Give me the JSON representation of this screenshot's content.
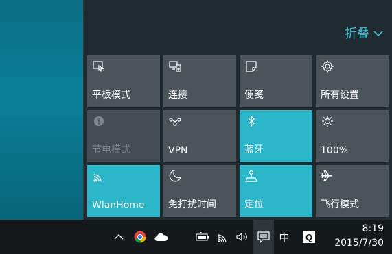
{
  "action_center": {
    "collapse_label": "折叠",
    "tiles": [
      {
        "label": "平板模式",
        "icon": "tablet-mode-icon",
        "state": "normal"
      },
      {
        "label": "连接",
        "icon": "connect-icon",
        "state": "normal"
      },
      {
        "label": "便笺",
        "icon": "note-icon",
        "state": "normal"
      },
      {
        "label": "所有设置",
        "icon": "settings-gear-icon",
        "state": "normal"
      },
      {
        "label": "节电模式",
        "icon": "battery-saver-icon",
        "state": "disabled"
      },
      {
        "label": "VPN",
        "icon": "vpn-icon",
        "state": "normal"
      },
      {
        "label": "蓝牙",
        "icon": "bluetooth-icon",
        "state": "active"
      },
      {
        "label": "100%",
        "icon": "brightness-icon",
        "state": "normal"
      },
      {
        "label": "WlanHome",
        "icon": "wifi-icon",
        "state": "active"
      },
      {
        "label": "免打扰时间",
        "icon": "moon-icon",
        "state": "normal"
      },
      {
        "label": "定位",
        "icon": "location-icon",
        "state": "active"
      },
      {
        "label": "飞行模式",
        "icon": "airplane-icon",
        "state": "normal"
      }
    ]
  },
  "taskbar": {
    "ime_label": "中",
    "q_label": "Q",
    "time": "8:19",
    "date": "2015/7/30"
  },
  "colors": {
    "accent": "#2bb6c9",
    "tile": "#4a5459",
    "panel": "#1f2b31",
    "taskbar": "#15191b",
    "collapse_text": "#3dc0d3"
  }
}
